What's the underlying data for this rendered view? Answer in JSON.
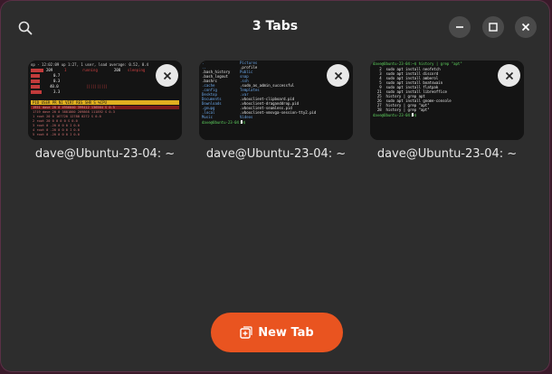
{
  "header": {
    "title": "3 Tabs"
  },
  "colors": {
    "accent": "#e95420",
    "background": "#2d2d2d"
  },
  "tabs": [
    {
      "label": "dave@Ubuntu-23-04: ~",
      "preview": "htop-output"
    },
    {
      "label": "dave@Ubuntu-23-04: ~",
      "preview": "ls-output"
    },
    {
      "label": "dave@Ubuntu-23-04: ~",
      "preview": "history-grep-output"
    }
  ],
  "previews": {
    "ls": {
      "left": [
        ".",
        "..",
        ".bash_history",
        ".bash_logout",
        ".bashrc",
        ".cache",
        ".config",
        "Desktop",
        "Documents",
        "Downloads",
        ".gnupg",
        ".local",
        "Music"
      ],
      "right": [
        "Pictures",
        ".profile",
        "Public",
        "snap",
        ".ssh",
        ".sudo_as_admin_successful",
        "Templates",
        ".var",
        ".vboxclient-clipboard.pid",
        ".vboxclient-draganddrop.pid",
        ".vboxclient-seamless.pid",
        ".vboxclient-vmsvga-session-tty2.pid",
        "Videos"
      ],
      "prompt": "dave@Ubuntu-23-04:~$"
    },
    "history": {
      "prompt_line": "dave@Ubuntu-23-04:~$ history | grep \"apt\"",
      "lines": [
        "   2  sudo apt install neofetch",
        "   3  sudo apt install discord",
        "   4  sudo apt install amberol",
        "   5  sudo apt install boatswain",
        "   9  sudo apt install flatpak",
        "  21  sudo apt install libreoffice",
        "  25  history | grep apt",
        "  26  sudo apt install gnome-console",
        "  27  history | grep \"apt\"",
        "  28  history | grep \"apt\""
      ],
      "prompt": "dave@Ubuntu-23-04:~$"
    },
    "htop": {
      "top_line": "op - 12:02:09 up 1:27,  1 user,  load average: 0.52, 0.4",
      "summary": [
        "Tasks: 209 total,   1 running, 208 sleeping,   0 st",
        "%Cpu(s):  0.7 us,  0.3 sy",
        "MiB Mem :   40.0 total",
        "MiB Swap:    3.3 total"
      ],
      "header": "  PID USER      PR  NI    VIRT    RES    SHR S  %CPU"
    }
  },
  "new_tab": {
    "label": "New Tab"
  }
}
